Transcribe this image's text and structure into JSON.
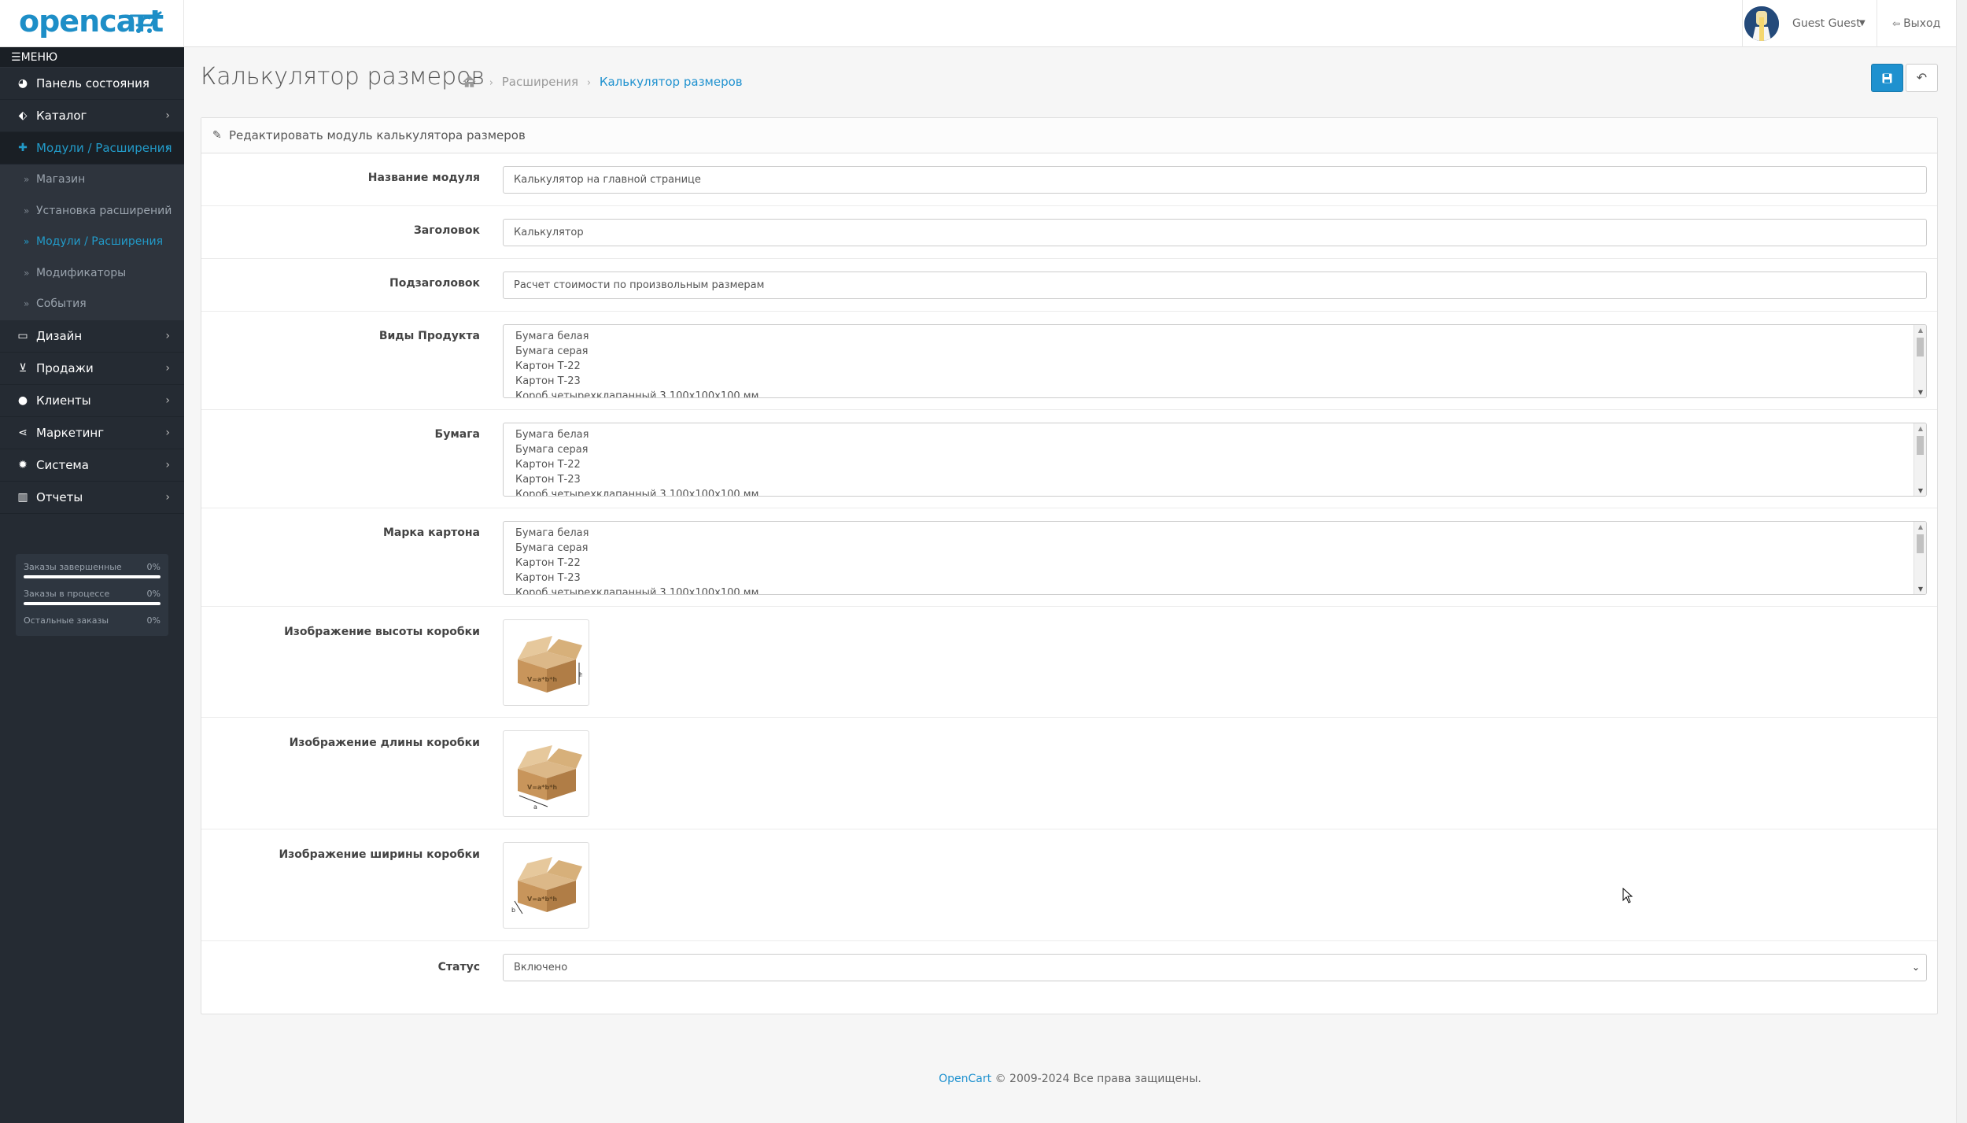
{
  "header": {
    "logo_text": "opencart",
    "user_name": "Guest Guest",
    "logout_label": "Выход"
  },
  "sidebar": {
    "menu_label": "МЕНЮ",
    "items": [
      {
        "label": "Панель состояния",
        "icon": "dashboard-icon"
      },
      {
        "label": "Каталог",
        "icon": "tags-icon"
      },
      {
        "label": "Модули / Расширения",
        "icon": "puzzle-icon"
      },
      {
        "label": "Дизайн",
        "icon": "monitor-icon"
      },
      {
        "label": "Продажи",
        "icon": "shopping-cart-icon"
      },
      {
        "label": "Клиенты",
        "icon": "user-icon"
      },
      {
        "label": "Маркетинг",
        "icon": "share-icon"
      },
      {
        "label": "Система",
        "icon": "cog-icon"
      },
      {
        "label": "Отчеты",
        "icon": "bar-chart-icon"
      }
    ],
    "sub_items": [
      {
        "label": "Магазин"
      },
      {
        "label": "Установка расширений"
      },
      {
        "label": "Модули / Расширения"
      },
      {
        "label": "Модификаторы"
      },
      {
        "label": "События"
      }
    ],
    "stats": [
      {
        "label": "Заказы завершенные",
        "value": "0%"
      },
      {
        "label": "Заказы в процессе",
        "value": "0%"
      },
      {
        "label": "Остальные заказы",
        "value": "0%"
      }
    ]
  },
  "page": {
    "title": "Калькулятор размеров",
    "breadcrumb": [
      "Расширения",
      "Калькулятор размеров"
    ],
    "panel_title": "Редактировать модуль калькулятора размеров"
  },
  "form": {
    "name_label": "Название модуля",
    "name_value": "Калькулятор на главной странице",
    "heading_label": "Заголовок",
    "heading_value": "Калькулятор",
    "subheading_label": "Подзаголовок",
    "subheading_value": "Расчет стоимости по произвольным размерам",
    "product_types_label": "Виды Продукта",
    "paper_label": "Бумага",
    "cardboard_label": "Марка картона",
    "options": [
      "Бумага белая",
      "Бумага серая",
      "Картон Т-22",
      "Картон Т-23",
      "Короб четырехклапанный 3 100х100х100 мм"
    ],
    "height_image_label": "Изображение высоты коробки",
    "length_image_label": "Изображение длины коробки",
    "width_image_label": "Изображение ширины коробки",
    "box_print": "V=a*b*h",
    "status_label": "Статус",
    "status_value": "Включено"
  },
  "footer": {
    "brand": "OpenCart",
    "copyright": " © 2009-2024 Все права защищены."
  },
  "colors": {
    "accent": "#1e91cf",
    "sidebar_bg": "#252b33",
    "box_brown": "#c8955b"
  }
}
